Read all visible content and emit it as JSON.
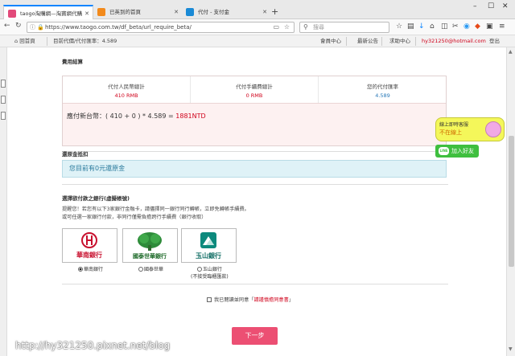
{
  "browser": {
    "tabs": [
      {
        "label": "taogo淘購網—淘寶網代購",
        "active": true
      },
      {
        "label": "已英到的首頁",
        "active": false
      },
      {
        "label": "代付 - 支付金",
        "active": false
      }
    ],
    "url": "https://www.taogo.com.tw/df_beta/url_require_beta/",
    "search_placeholder": "搜尋",
    "accent": "#0a84ff"
  },
  "site_header": {
    "home": "回首頁",
    "rate_label": "目前代價/代付匯率：4.589",
    "member_center": "會員中心",
    "news": "最新公告",
    "help_center": "求助中心",
    "email": "hy321250@hotmail.com",
    "logout": "登出"
  },
  "fee": {
    "title": "費用結算",
    "cols": [
      {
        "label": "代付人民幣總計",
        "value": "410 RMB"
      },
      {
        "label": "代付手續費總計",
        "value": "0 RMB"
      },
      {
        "label": "您的代付匯率",
        "value": "4.589"
      }
    ],
    "total_prefix": "應付新台幣：( 410 + 0 ) * 4.589 = ",
    "total_value": "1881NTD"
  },
  "refund": {
    "title": "還原金抵扣",
    "message": "您目前有0元還原金"
  },
  "bank": {
    "title": "選擇欲付款之銀行(虛擬帳號)",
    "note1": "提醒您！若您有以下3家銀行金融卡，請儘擇同一銀行同行轉帳，立即免轉帳手續費。",
    "note2": "或可任選一家銀行付款，非同行僅需負擔跨行手續費（銀行收取）",
    "options": [
      {
        "name": "華南銀行",
        "logo_text": "華南銀行",
        "selected": true,
        "sub": ""
      },
      {
        "name": "國泰世華",
        "logo_text": "國泰世華銀行",
        "selected": false,
        "sub": ""
      },
      {
        "name": "玉山銀行",
        "logo_text": "玉山銀行",
        "selected": false,
        "sub": "(不接受臨櫃匯款)"
      }
    ]
  },
  "agreement": {
    "text": "我已閱讀並同意「",
    "link": "請謹慎擔同意書",
    "suffix": "」"
  },
  "next_button": "下一步",
  "widgets": {
    "cs_line1": "線上即時客服",
    "cs_line2": "不在線上",
    "line_label": "加入好友",
    "line_logo": "LINE"
  },
  "watermark": "http://hy321250.pixnet.net/blog",
  "colors": {
    "brand_red": "#d0021b",
    "next_button": "#ec4f73",
    "refund_bg": "#dff2f7"
  }
}
